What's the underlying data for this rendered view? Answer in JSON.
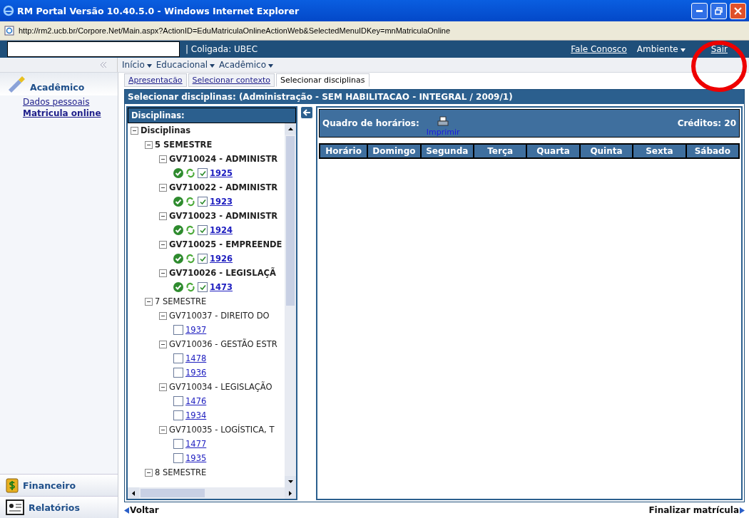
{
  "window": {
    "title": "RM Portal Versão 10.40.5.0 - Windows Internet Explorer",
    "address": "http://rm2.ucb.br/Corpore.Net/Main.aspx?ActionID=EduMatriculaOnlineActionWeb&SelectedMenuIDKey=mnMatriculaOnline"
  },
  "topbar": {
    "coligada": "| Coligada: UBEC",
    "links": [
      {
        "label": "Fale Conosco",
        "kind": "link"
      },
      {
        "label": "Ambiente",
        "kind": "menu"
      },
      {
        "label": "Sair",
        "kind": "link"
      }
    ]
  },
  "menu": [
    {
      "label": "Início"
    },
    {
      "label": "Educacional"
    },
    {
      "label": "Acadêmico"
    }
  ],
  "sidebar": {
    "section": "Acadêmico",
    "items": [
      {
        "label": "Dados pessoais",
        "selected": false
      },
      {
        "label": "Matricula online",
        "selected": true
      }
    ],
    "bottom": [
      {
        "label": "Financeiro",
        "kind": "money"
      },
      {
        "label": "Relatórios",
        "kind": "report"
      }
    ]
  },
  "tabs": [
    {
      "label": "Apresentacão",
      "selected": false
    },
    {
      "label": "Selecionar contexto",
      "selected": false
    },
    {
      "label": "Selecionar disciplinas",
      "selected": true
    }
  ],
  "panel_title": "Selecionar disciplinas: (Administração - SEM HABILITACAO - INTEGRAL / 2009/1)",
  "tree": {
    "header": "Disciplinas:",
    "root": {
      "label": "Disciplinas",
      "expanded": true,
      "enrolled": true,
      "children": [
        {
          "label": "5 SEMESTRE",
          "expanded": true,
          "enrolled": true,
          "children": [
            {
              "label": "GV710024 - ADMINISTR",
              "expanded": true,
              "enrolled": true,
              "children": [
                {
                  "kind": "class",
                  "code": "1925",
                  "checked": true
                }
              ]
            },
            {
              "label": "GV710022 - ADMINISTR",
              "expanded": true,
              "enrolled": true,
              "children": [
                {
                  "kind": "class",
                  "code": "1923",
                  "checked": true
                }
              ]
            },
            {
              "label": "GV710023 - ADMINISTR",
              "expanded": true,
              "enrolled": true,
              "children": [
                {
                  "kind": "class",
                  "code": "1924",
                  "checked": true
                }
              ]
            },
            {
              "label": "GV710025 - EMPREENDE",
              "expanded": true,
              "enrolled": true,
              "children": [
                {
                  "kind": "class",
                  "code": "1926",
                  "checked": true
                }
              ]
            },
            {
              "label": "GV710026 - LEGISLAÇÃ",
              "expanded": true,
              "enrolled": true,
              "children": [
                {
                  "kind": "class",
                  "code": "1473",
                  "checked": true
                }
              ]
            }
          ]
        },
        {
          "label": "7 SEMESTRE",
          "expanded": true,
          "enrolled": false,
          "children": [
            {
              "label": "GV710037 - DIREITO DO",
              "expanded": true,
              "enrolled": false,
              "children": [
                {
                  "kind": "class",
                  "code": "1937",
                  "checked": false
                }
              ]
            },
            {
              "label": "GV710036 - GESTÃO ESTR",
              "expanded": true,
              "enrolled": false,
              "children": [
                {
                  "kind": "class",
                  "code": "1478",
                  "checked": false
                },
                {
                  "kind": "class",
                  "code": "1936",
                  "checked": false
                }
              ]
            },
            {
              "label": "GV710034 - LEGISLAÇÃO",
              "expanded": true,
              "enrolled": false,
              "children": [
                {
                  "kind": "class",
                  "code": "1476",
                  "checked": false
                },
                {
                  "kind": "class",
                  "code": "1934",
                  "checked": false
                }
              ]
            },
            {
              "label": "GV710035 - LOGÍSTICA, T",
              "expanded": true,
              "enrolled": false,
              "children": [
                {
                  "kind": "class",
                  "code": "1477",
                  "checked": false
                },
                {
                  "kind": "class",
                  "code": "1935",
                  "checked": false
                }
              ]
            }
          ]
        },
        {
          "label": "8 SEMESTRE",
          "expanded": true,
          "enrolled": false
        }
      ]
    }
  },
  "schedule": {
    "title": "Quadro de horários:",
    "print": "Imprimir",
    "credits": "Créditos: 20",
    "columns": [
      "Horário",
      "Domingo",
      "Segunda",
      "Terça",
      "Quarta",
      "Quinta",
      "Sexta",
      "Sábado"
    ]
  },
  "footer": {
    "back": "Voltar",
    "finish": "Finalizar matrícula"
  }
}
